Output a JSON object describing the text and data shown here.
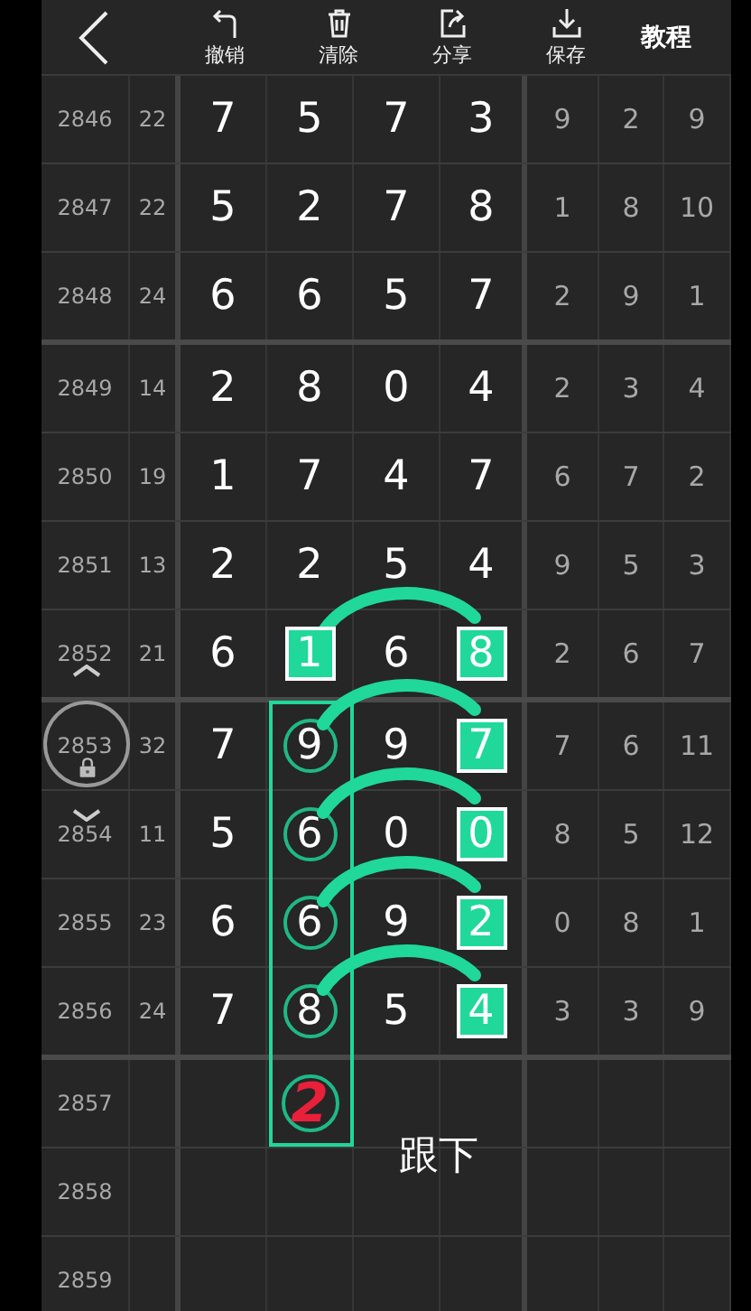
{
  "toolbar": {
    "tools": [
      {
        "kind": "undo",
        "label": "撤销"
      },
      {
        "kind": "clear",
        "label": "清除"
      },
      {
        "kind": "share",
        "label": "分享"
      },
      {
        "kind": "save",
        "label": "保存"
      }
    ],
    "help": "教程"
  },
  "rows": [
    {
      "period": "2846",
      "sum": "22",
      "digits": [
        {
          "value": "7"
        },
        {
          "value": "5"
        },
        {
          "value": "7"
        },
        {
          "value": "3"
        }
      ],
      "tail": [
        "9",
        "2",
        "9"
      ],
      "group_end": false,
      "in_box": false
    },
    {
      "period": "2847",
      "sum": "22",
      "digits": [
        {
          "value": "5"
        },
        {
          "value": "2"
        },
        {
          "value": "7"
        },
        {
          "value": "8"
        }
      ],
      "tail": [
        "1",
        "8",
        "10"
      ],
      "group_end": false,
      "in_box": false
    },
    {
      "period": "2848",
      "sum": "24",
      "digits": [
        {
          "value": "6"
        },
        {
          "value": "6"
        },
        {
          "value": "5"
        },
        {
          "value": "7"
        }
      ],
      "tail": [
        "2",
        "9",
        "1"
      ],
      "group_end": true,
      "in_box": false
    },
    {
      "period": "2849",
      "sum": "14",
      "digits": [
        {
          "value": "2"
        },
        {
          "value": "8"
        },
        {
          "value": "0"
        },
        {
          "value": "4"
        }
      ],
      "tail": [
        "2",
        "3",
        "4"
      ],
      "group_end": false,
      "in_box": false
    },
    {
      "period": "2850",
      "sum": "19",
      "digits": [
        {
          "value": "1"
        },
        {
          "value": "7"
        },
        {
          "value": "4"
        },
        {
          "value": "7"
        }
      ],
      "tail": [
        "6",
        "7",
        "2"
      ],
      "group_end": false,
      "in_box": false
    },
    {
      "period": "2851",
      "sum": "13",
      "digits": [
        {
          "value": "2"
        },
        {
          "value": "2"
        },
        {
          "value": "5"
        },
        {
          "value": "4"
        }
      ],
      "tail": [
        "9",
        "5",
        "3"
      ],
      "group_end": false,
      "in_box": false
    },
    {
      "period": "2852",
      "sum": "21",
      "digits": [
        {
          "value": "6"
        },
        {
          "value": "1",
          "boxed": true
        },
        {
          "value": "6"
        },
        {
          "value": "8",
          "boxed": true
        }
      ],
      "tail": [
        "2",
        "6",
        "7"
      ],
      "group_end": true,
      "in_box": false
    },
    {
      "period": "2853",
      "sum": "32",
      "digits": [
        {
          "value": "7"
        },
        {
          "value": "9",
          "circled": true
        },
        {
          "value": "9"
        },
        {
          "value": "7",
          "boxed": true
        }
      ],
      "tail": [
        "7",
        "6",
        "11"
      ],
      "group_end": false,
      "in_box": true
    },
    {
      "period": "2854",
      "sum": "11",
      "digits": [
        {
          "value": "5"
        },
        {
          "value": "6",
          "circled": true
        },
        {
          "value": "0"
        },
        {
          "value": "0",
          "boxed": true
        }
      ],
      "tail": [
        "8",
        "5",
        "12"
      ],
      "group_end": false,
      "in_box": true
    },
    {
      "period": "2855",
      "sum": "23",
      "digits": [
        {
          "value": "6"
        },
        {
          "value": "6",
          "circled": true
        },
        {
          "value": "9"
        },
        {
          "value": "2",
          "boxed": true
        }
      ],
      "tail": [
        "0",
        "8",
        "1"
      ],
      "group_end": false,
      "in_box": true
    },
    {
      "period": "2856",
      "sum": "24",
      "digits": [
        {
          "value": "7"
        },
        {
          "value": "8",
          "circled": true
        },
        {
          "value": "5"
        },
        {
          "value": "4",
          "boxed": true
        }
      ],
      "tail": [
        "3",
        "3",
        "9"
      ],
      "group_end": true,
      "in_box": true
    },
    {
      "period": "2857",
      "sketch": {
        "value": "2",
        "circled": true,
        "color": "#e8203a"
      },
      "note": "跟下",
      "group_end": false,
      "in_box": true
    },
    {
      "period": "2858",
      "group_end": false,
      "in_box": false
    },
    {
      "period": "2859",
      "group_end": false,
      "in_box": false
    }
  ]
}
